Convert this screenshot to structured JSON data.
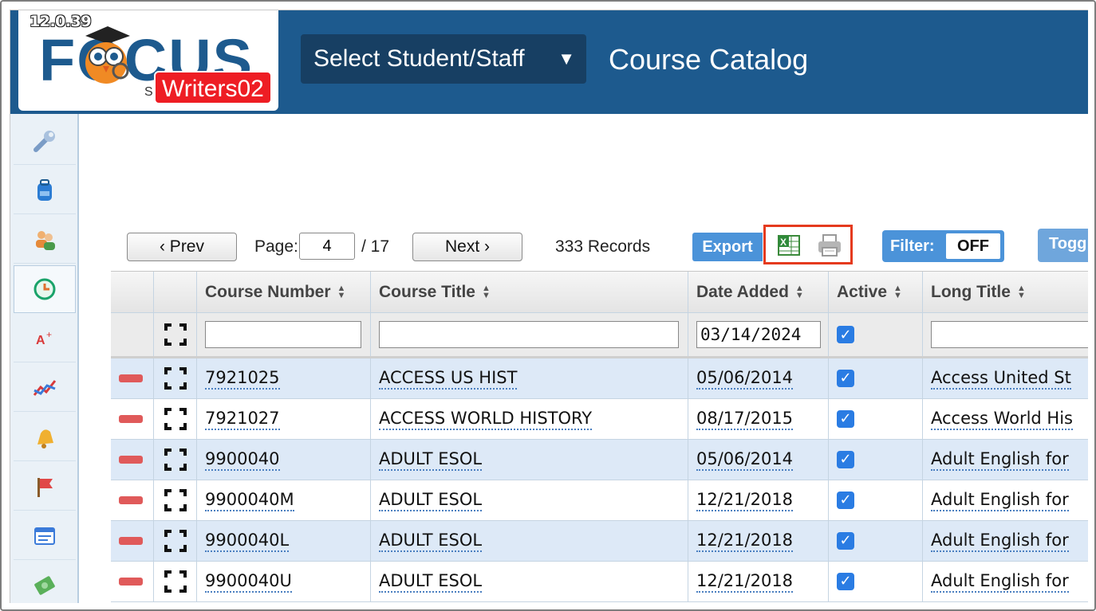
{
  "app": {
    "version": "12.0.39",
    "logo_text": "FOCUS",
    "school": "Writers02",
    "school_prefix": "S",
    "select_button": "Select Student/Staff",
    "select_caret": "▼",
    "page_title": "Course Catalog"
  },
  "sidebar": {
    "items": [
      {
        "icon": "wrench-icon"
      },
      {
        "icon": "backpack-icon"
      },
      {
        "icon": "users-icon"
      },
      {
        "icon": "clock-icon"
      },
      {
        "icon": "grades-icon"
      },
      {
        "icon": "chart-icon"
      },
      {
        "icon": "bell-icon"
      },
      {
        "icon": "flag-icon"
      },
      {
        "icon": "form-icon"
      },
      {
        "icon": "money-icon"
      }
    ]
  },
  "toolbar": {
    "prev_label": "‹ Prev",
    "page_label": "Page:",
    "page_value": "4",
    "page_total": "/ 17",
    "next_label": "Next ›",
    "records": "333 Records",
    "export_label": "Export",
    "filter_label": "Filter:",
    "filter_state": "OFF",
    "toggle_label": "Togg"
  },
  "table": {
    "headers": [
      "Course Number",
      "Course Title",
      "Date Added",
      "Active",
      "Long Title"
    ],
    "filters": {
      "course_number": "",
      "course_title": "",
      "date_added": "03/14/2024",
      "long_title": ""
    },
    "rows": [
      {
        "number": "7921025",
        "title": "ACCESS US HIST",
        "date": "05/06/2014",
        "active": true,
        "long": "Access United St"
      },
      {
        "number": "7921027",
        "title": "ACCESS WORLD HISTORY",
        "date": "08/17/2015",
        "active": true,
        "long": "Access World His"
      },
      {
        "number": "9900040",
        "title": "ADULT ESOL",
        "date": "05/06/2014",
        "active": true,
        "long": "Adult English for"
      },
      {
        "number": "9900040M",
        "title": "ADULT ESOL",
        "date": "12/21/2018",
        "active": true,
        "long": "Adult English for"
      },
      {
        "number": "9900040L",
        "title": "ADULT ESOL",
        "date": "12/21/2018",
        "active": true,
        "long": "Adult English for"
      },
      {
        "number": "9900040U",
        "title": "ADULT ESOL",
        "date": "12/21/2018",
        "active": true,
        "long": "Adult English for"
      }
    ]
  }
}
